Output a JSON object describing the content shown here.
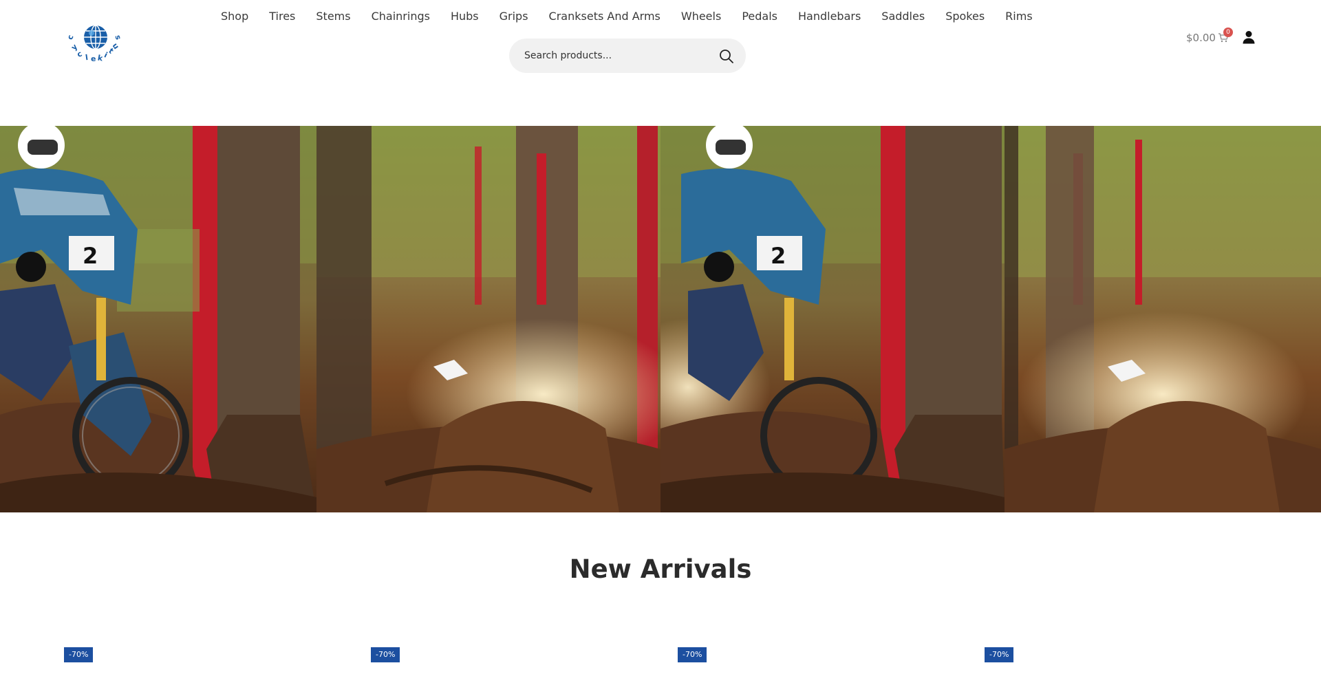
{
  "brand": {
    "logo_text": "cyclekitus",
    "logo_color": "#1a5fa8"
  },
  "nav": {
    "items": [
      "Shop",
      "Tires",
      "Stems",
      "Chainrings",
      "Hubs",
      "Grips",
      "Cranksets And Arms",
      "Wheels",
      "Pedals",
      "Handlebars",
      "Saddles",
      "Spokes",
      "Rims"
    ]
  },
  "search": {
    "placeholder": "Search products...",
    "icon": "search-icon"
  },
  "cart": {
    "total": "$0.00",
    "count": "0",
    "icon": "cart-icon",
    "badge_color": "#d9534f"
  },
  "account": {
    "icon": "user-icon"
  },
  "hero": {
    "image": "downhill mountain bike rider in forest banner"
  },
  "new_arrivals": {
    "title": "New Arrivals",
    "badges": [
      "-70%",
      "-70%",
      "-70%",
      "-70%"
    ],
    "badge_color": "#1c4fa0"
  }
}
